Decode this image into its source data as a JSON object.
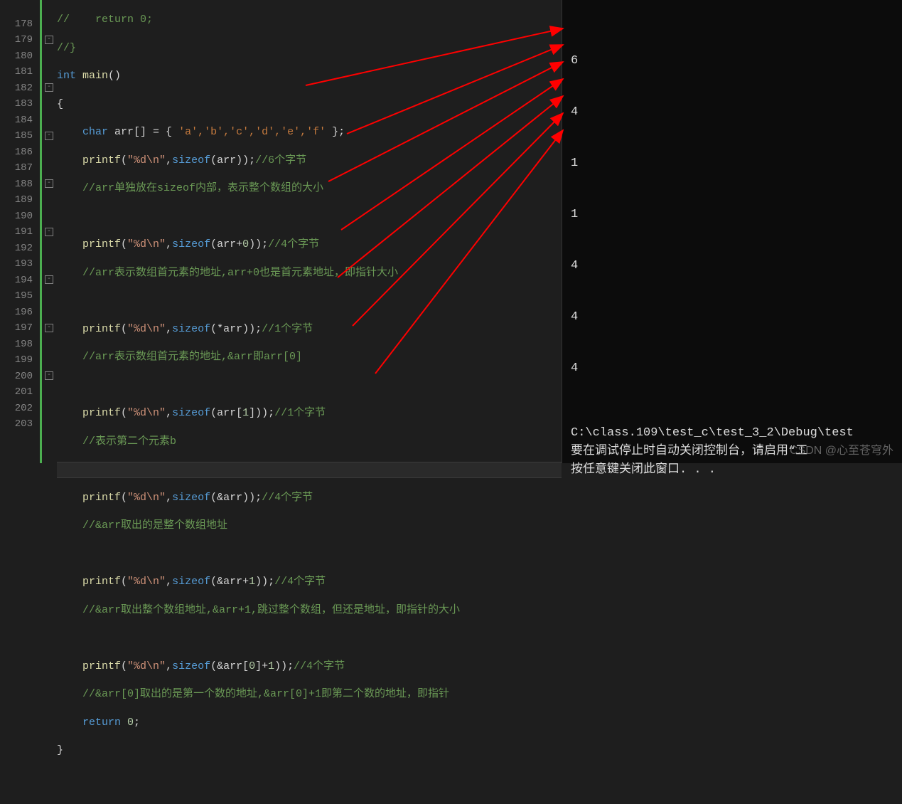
{
  "editor": {
    "line_numbers": [
      "",
      "178",
      "179",
      "180",
      "181",
      "182",
      "183",
      "184",
      "185",
      "186",
      "187",
      "188",
      "189",
      "190",
      "191",
      "192",
      "193",
      "194",
      "195",
      "196",
      "197",
      "198",
      "199",
      "200",
      "201",
      "202",
      "203"
    ],
    "code": {
      "l0": "//    return 0;",
      "l1": "//}",
      "kw_int": "int",
      "fn_main": "main",
      "main_parens": "()",
      "brace_open": "{",
      "kw_char": "char",
      "arr_decl": " arr[] = { ",
      "ch_a": "'a',",
      "ch_b": "'b',",
      "ch_c": "'c',",
      "ch_d": "'d',",
      "ch_e": "'e',",
      "ch_f": "'f'",
      "arr_end": " };",
      "fn_printf": "printf",
      "open_p": "(",
      "fmt": "\"%d\\n\"",
      "comma": ",",
      "kw_sizeof": "sizeof",
      "arg1": "(arr));",
      "c1": "//6个字节",
      "c1b": "//arr单独放在sizeof内部，表示整个数组的大小",
      "arg2": "(arr+",
      "zero": "0",
      "close_p": "));",
      "c2": "//4个字节",
      "c2b": "//arr表示数组首元素的地址,arr+0也是首元素地址，即指针大小",
      "arg3": "(*arr));",
      "c3": "//1个字节",
      "c3b": "//arr表示数组首元素的地址,&arr即arr[0]",
      "arg4": "(arr[",
      "one": "1",
      "arg4b": "]));",
      "c4": "//1个字节",
      "c4b": "//表示第二个元素b",
      "arg5": "(&arr));",
      "c5": "//4个字节",
      "c5b": "//&arr取出的是整个数组地址",
      "arg6": "(&arr+",
      "c6": "//4个字节",
      "c6b": "//&arr取出整个数组地址,&arr+1,跳过整个数组，但还是地址，即指针的大小",
      "arg7": "(&arr[",
      "arg7b": "]+",
      "c7": "//4个字节",
      "c7b": "//&arr[0]取出的是第一个数的地址,&arr[0]+1即第二个数的地址，即指针",
      "kw_return": "return",
      "ret_zero": " 0",
      "semi": ";",
      "brace_close": "}"
    }
  },
  "console": {
    "output": [
      "6",
      "4",
      "1",
      "1",
      "4",
      "4",
      "4"
    ],
    "msg1": "C:\\class.109\\test_c\\test_3_2\\Debug\\test",
    "msg2": "要在调试停止时自动关闭控制台，请启用“工",
    "msg3": "按任意键关闭此窗口. . ."
  },
  "watermark": "CSDN @心至苍穹外"
}
